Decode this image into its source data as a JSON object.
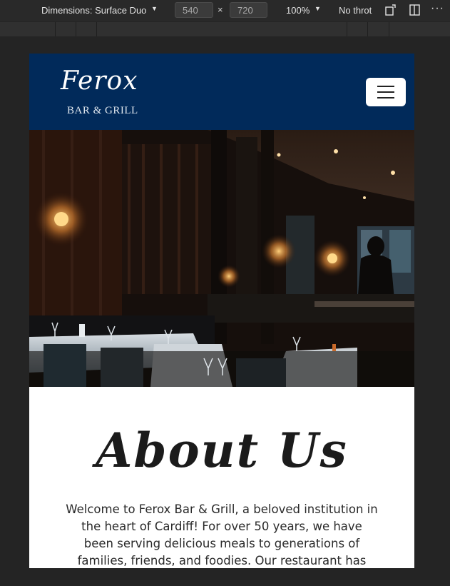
{
  "devtools": {
    "dimensions_label": "Dimensions: Surface Duo",
    "width_value": "540",
    "height_value": "720",
    "times": "×",
    "zoom": "100%",
    "throttle": "No throt",
    "more": "⋮"
  },
  "navbar": {
    "logo_script": "Ferox",
    "logo_sub": "BAR & GRILL",
    "background": "#012a5a"
  },
  "hero": {
    "scene": "dimly lit restaurant dining room with set tables"
  },
  "about": {
    "title": "About Us",
    "text": "Welcome to Ferox Bar & Grill, a beloved institution in the heart of Cardiff! For over 50 years, we have been serving delicious meals to generations of families, friends, and foodies. Our restaurant has stood the test"
  }
}
